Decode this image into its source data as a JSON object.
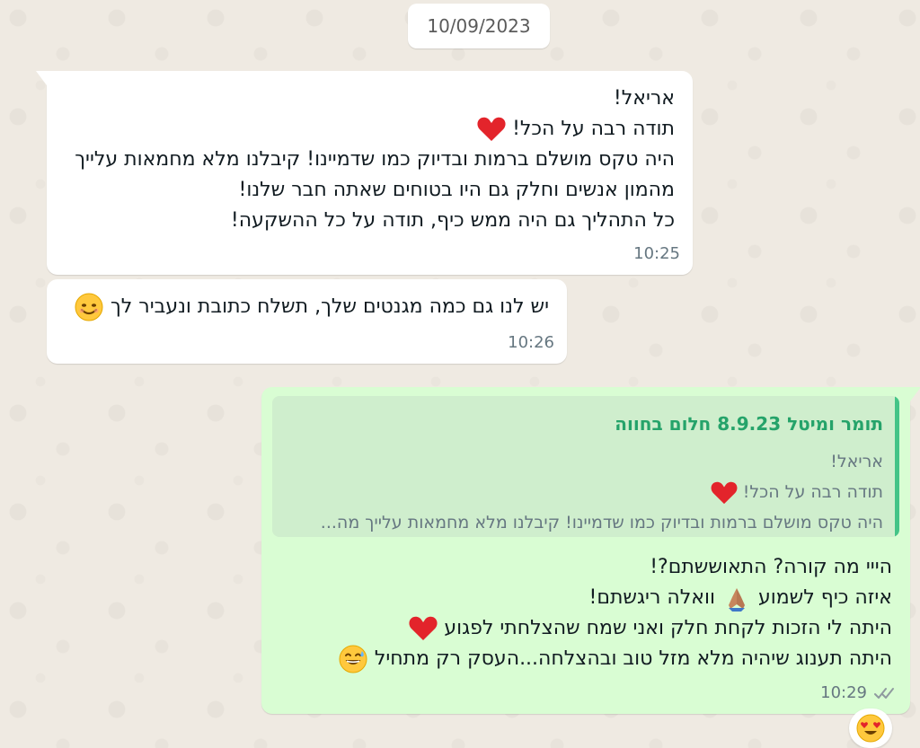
{
  "chat": {
    "date": "10/09/2023",
    "messages": [
      {
        "lines": [
          "אריאל!",
          "תודה רבה על הכל!",
          "היה טקס מושלם ברמות ובדיוק כמו שדמיינו! קיבלנו מלא מחמאות עלייך",
          "מהמון אנשים וחלק גם היו בטוחים שאתה חבר שלנו!",
          "כל התהליך גם היה ממש כיף, תודה על כל ההשקעה!"
        ],
        "time": "10:25"
      },
      {
        "text": "יש לנו גם כמה מגנטים שלך, תשלח כתובת ונעביר לך",
        "time": "10:26"
      },
      {
        "reply": {
          "title": "תומר ומיטל 8.9.23 חלום בחווה",
          "lines": [
            "אריאל!",
            "תודה רבה על הכל!",
            "היה טקס מושלם ברמות ובדיוק כמו שדמיינו! קיבלנו מלא מחמאות עלייך מה..."
          ]
        },
        "lines": [
          "הייי מה קורה? התאוששתם?!",
          "איזה כיף לשמוע",
          "וואלה ריגשתם!",
          "היתה לי הזכות לקחת חלק ואני שמח שהצלחתי לפגוע",
          "היתה תענוג שיהיה מלא מזל טוב ובהצלחה...העסק רק מתחיל"
        ],
        "time": "10:29"
      }
    ]
  },
  "icons": {
    "heart": "heart-icon",
    "smile": "smiling-face-icon",
    "pray": "folded-hands-icon",
    "sweat": "grinning-sweat-icon",
    "heart_eyes": "heart-eyes-icon",
    "ticks": "double-check-icon"
  },
  "colors": {
    "background": "#efeae2",
    "incoming": "#ffffff",
    "outgoing": "#d9fdd3",
    "reply_bar": "#44c487",
    "reply_title": "#25a36a",
    "time": "#667781"
  }
}
